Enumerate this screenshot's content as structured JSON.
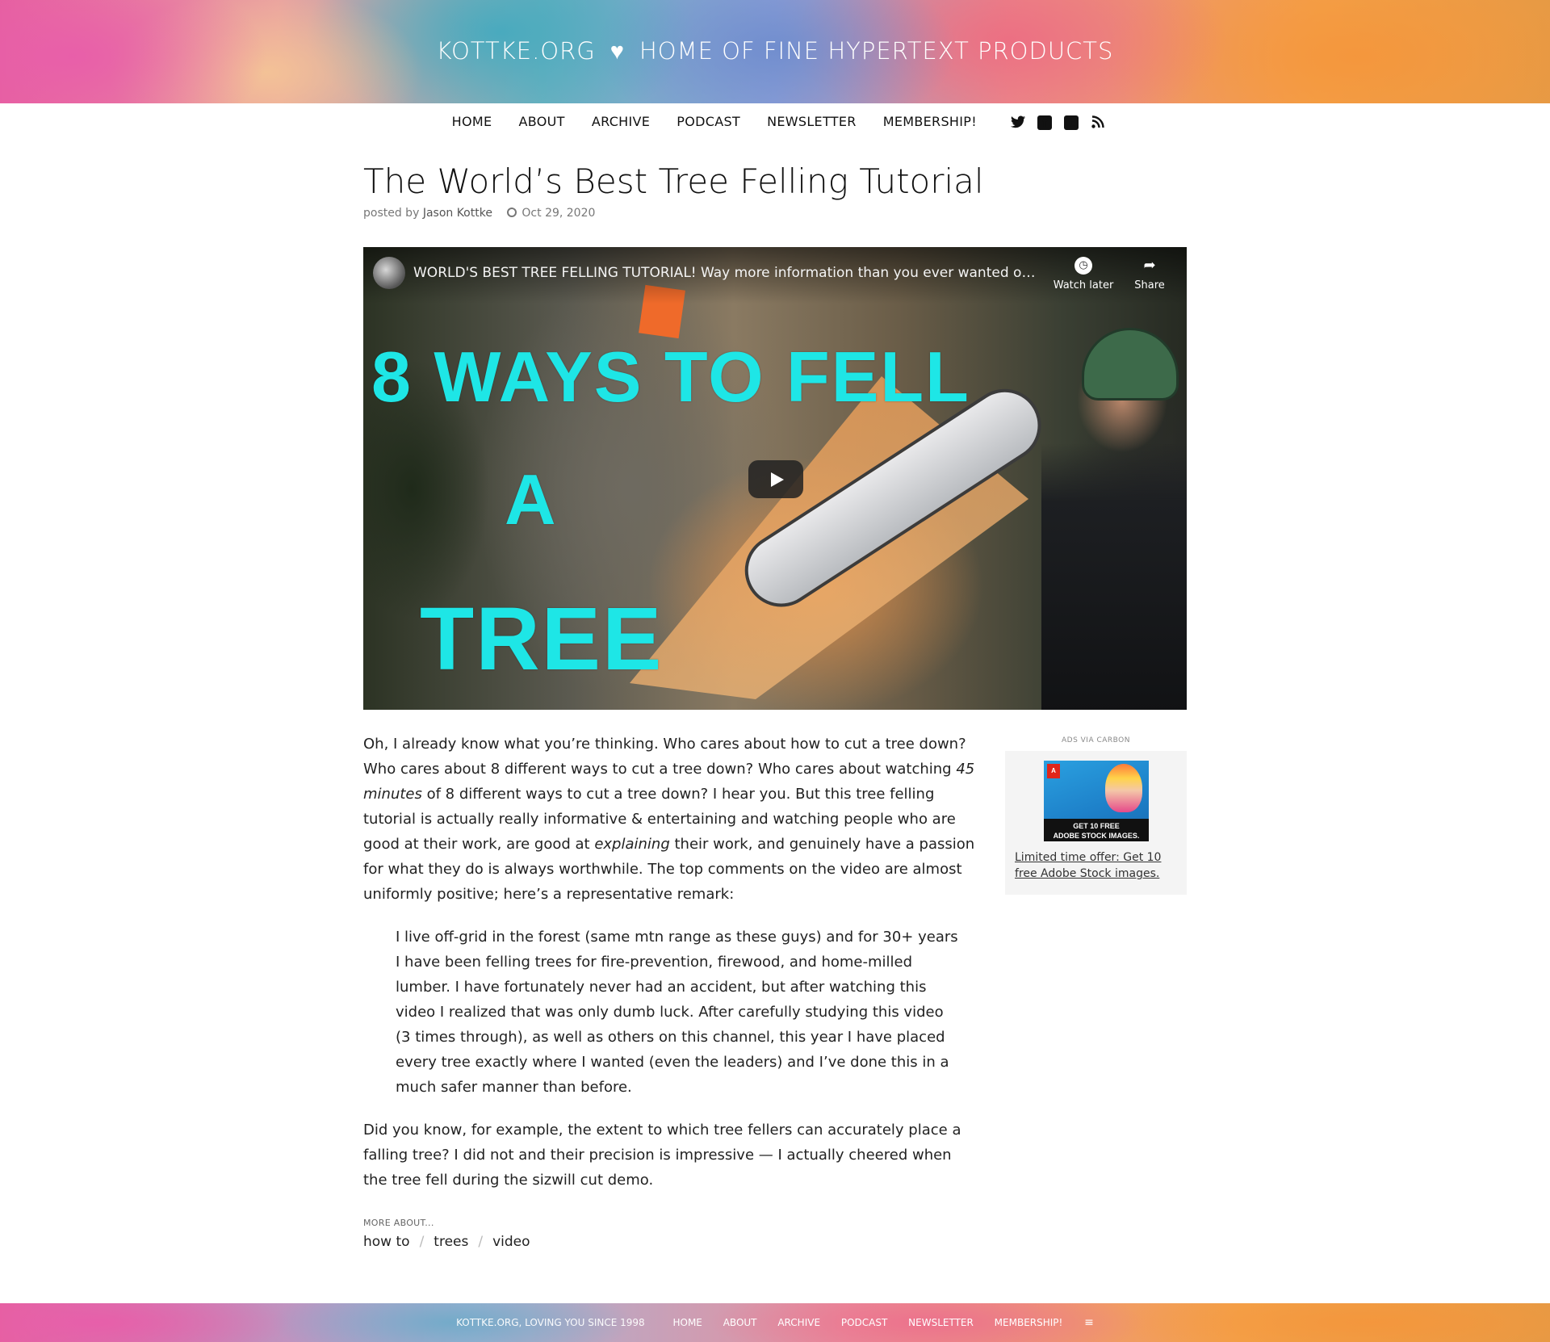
{
  "header": {
    "site": "KOTTKE.ORG",
    "heart": "♥",
    "tagline": "HOME OF FINE HYPERTEXT PRODUCTS"
  },
  "nav": {
    "items": [
      "HOME",
      "ABOUT",
      "ARCHIVE",
      "PODCAST",
      "NEWSLETTER",
      "MEMBERSHIP!"
    ],
    "social_icons": [
      "twitter-icon",
      "facebook-icon",
      "tumblr-icon",
      "rss-icon"
    ]
  },
  "post": {
    "title": "The World’s Best Tree Felling Tutorial",
    "posted_by_label": "posted by",
    "author": "Jason Kottke",
    "date": "Oct 29, 2020"
  },
  "video": {
    "title": "WORLD'S BEST TREE FELLING TUTORIAL! Way more information than you ever wanted on how t…",
    "watch_later": "Watch later",
    "share": "Share",
    "thumbnail_text": [
      "8 WAYS TO FELL",
      "A",
      "TREE"
    ]
  },
  "article": {
    "p1_a": "Oh, I already know what you’re thinking. Who cares about how to cut a tree down? Who cares about 8 different ways to cut a tree down? Who cares about watching ",
    "p1_em1": "45 minutes",
    "p1_b": " of 8 different ways to cut a tree down? I hear you. But this tree felling tutorial is actually really informative & entertaining and watching people who are good at their work, are good at ",
    "p1_em2": "explaining",
    "p1_c": " their work, and genuinely have a passion for what they do is always worthwhile. The top comments on the video are almost uniformly positive; here’s a representative remark:",
    "quote": "I live off-grid in the forest (same mtn range as these guys) and for 30+ years I have been felling trees for fire-prevention, firewood, and home-milled lumber. I have fortunately never had an accident, but after watching this video I realized that was only dumb luck. After carefully studying this video (3 times through), as well as others on this channel, this year I have placed every tree exactly where I wanted (even the leaders) and I’ve done this in a much safer manner than before.",
    "p2": "Did you know, for example, the extent to which tree fellers can accurately place a falling tree? I did not and their precision is impressive — I actually cheered when the tree fell during the sizwill cut demo."
  },
  "tags": {
    "label": "MORE ABOUT...",
    "items": [
      "how to",
      "trees",
      "video"
    ],
    "separator": "/"
  },
  "ad": {
    "label": "ADS VIA CARBON",
    "banner_line1": "GET 10 FREE",
    "banner_line2": "ADOBE STOCK IMAGES.",
    "logo": "A",
    "text": "Limited time offer: Get 10 free Adobe Stock images."
  },
  "footer": {
    "tagline": "KOTTKE.ORG, LOVING YOU SINCE 1998",
    "items": [
      "HOME",
      "ABOUT",
      "ARCHIVE",
      "PODCAST",
      "NEWSLETTER",
      "MEMBERSHIP!"
    ],
    "menu_icon": "≡"
  }
}
